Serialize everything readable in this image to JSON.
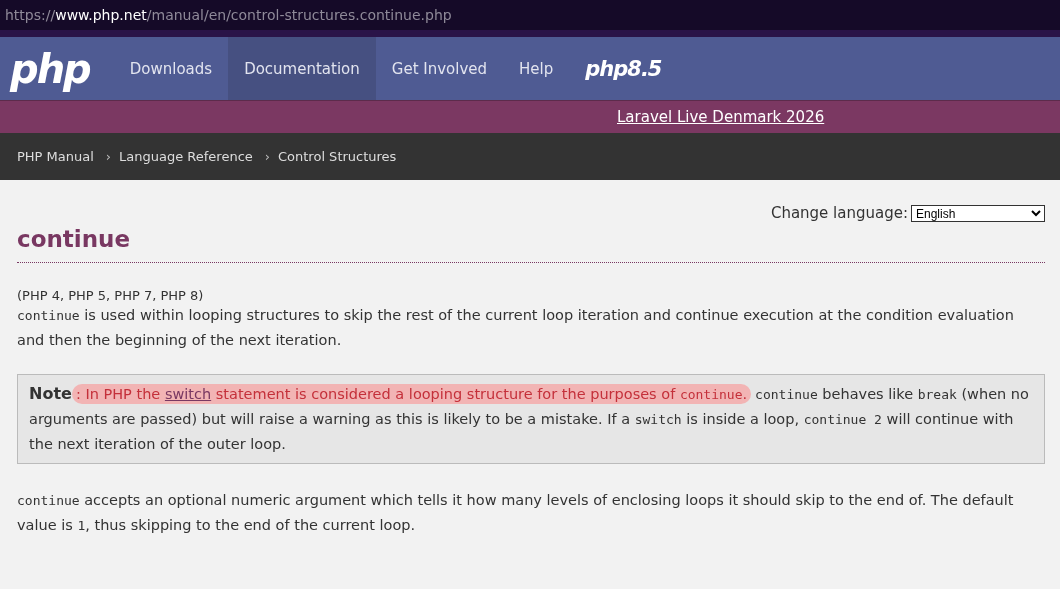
{
  "address_bar": {
    "segments": [
      {
        "text": "https://",
        "emphasis": false
      },
      {
        "text": "www.php.net",
        "emphasis": true
      },
      {
        "text": "/manual/en/control-structures.continue.php",
        "emphasis": false
      }
    ]
  },
  "nav": {
    "logo": "php",
    "items": [
      {
        "label": "Downloads",
        "selected": false
      },
      {
        "label": "Documentation",
        "selected": true
      },
      {
        "label": "Get Involved",
        "selected": false
      },
      {
        "label": "Help",
        "selected": false
      }
    ],
    "version_logo": {
      "name": "php",
      "version": "8.5"
    }
  },
  "banner": {
    "link": "Laravel Live Denmark 2026"
  },
  "breadcrumbs": [
    {
      "label": "PHP Manual"
    },
    {
      "separator": "›",
      "label": "Language Reference"
    },
    {
      "separator": "›",
      "label": "Control Structures"
    }
  ],
  "language": {
    "label": "Change language:",
    "value": "English"
  },
  "title": "continue",
  "versions": "(PHP 4, PHP 5, PHP 7, PHP 8)",
  "paragraphs": [
    {
      "kind": "plain",
      "segments": [
        {
          "kind": "code",
          "text": "continue"
        },
        {
          "kind": "text",
          "text": " is used within looping structures to skip the rest of the current loop iteration and continue execution at the condition evaluation and then the beginning of the next iteration."
        }
      ]
    },
    {
      "kind": "note",
      "segments": [
        {
          "kind": "strong",
          "text": "Note"
        },
        {
          "kind": "text",
          "text": ": In PHP the ",
          "highlighted": true
        },
        {
          "kind": "link",
          "text": "switch",
          "highlighted": true
        },
        {
          "kind": "text",
          "text": " statement is considered a looping structure for the purposes of ",
          "highlighted": true
        },
        {
          "kind": "code",
          "text": "continue",
          "highlighted": true
        },
        {
          "kind": "text",
          "text": ".",
          "highlighted": true
        },
        {
          "kind": "code",
          "text": "continue"
        },
        {
          "kind": "text",
          "text": " behaves like "
        },
        {
          "kind": "code",
          "text": "break"
        },
        {
          "kind": "text",
          "text": " (when no arguments are passed) but will raise a warning as this is likely to be a mistake. If a "
        },
        {
          "kind": "code",
          "text": "switch"
        },
        {
          "kind": "text",
          "text": " is inside a loop, "
        },
        {
          "kind": "code",
          "text": "continue 2"
        },
        {
          "kind": "text",
          "text": " will continue with the next iteration of the outer loop."
        }
      ]
    },
    {
      "kind": "plain",
      "segments": [
        {
          "kind": "code",
          "text": "continue"
        },
        {
          "kind": "text",
          "text": " accepts an optional numeric argument which tells it how many levels of enclosing loops it should skip to the end of. The default value is "
        },
        {
          "kind": "code",
          "text": "1"
        },
        {
          "kind": "text",
          "text": ", thus skipping to the end of the current loop."
        }
      ]
    }
  ]
}
